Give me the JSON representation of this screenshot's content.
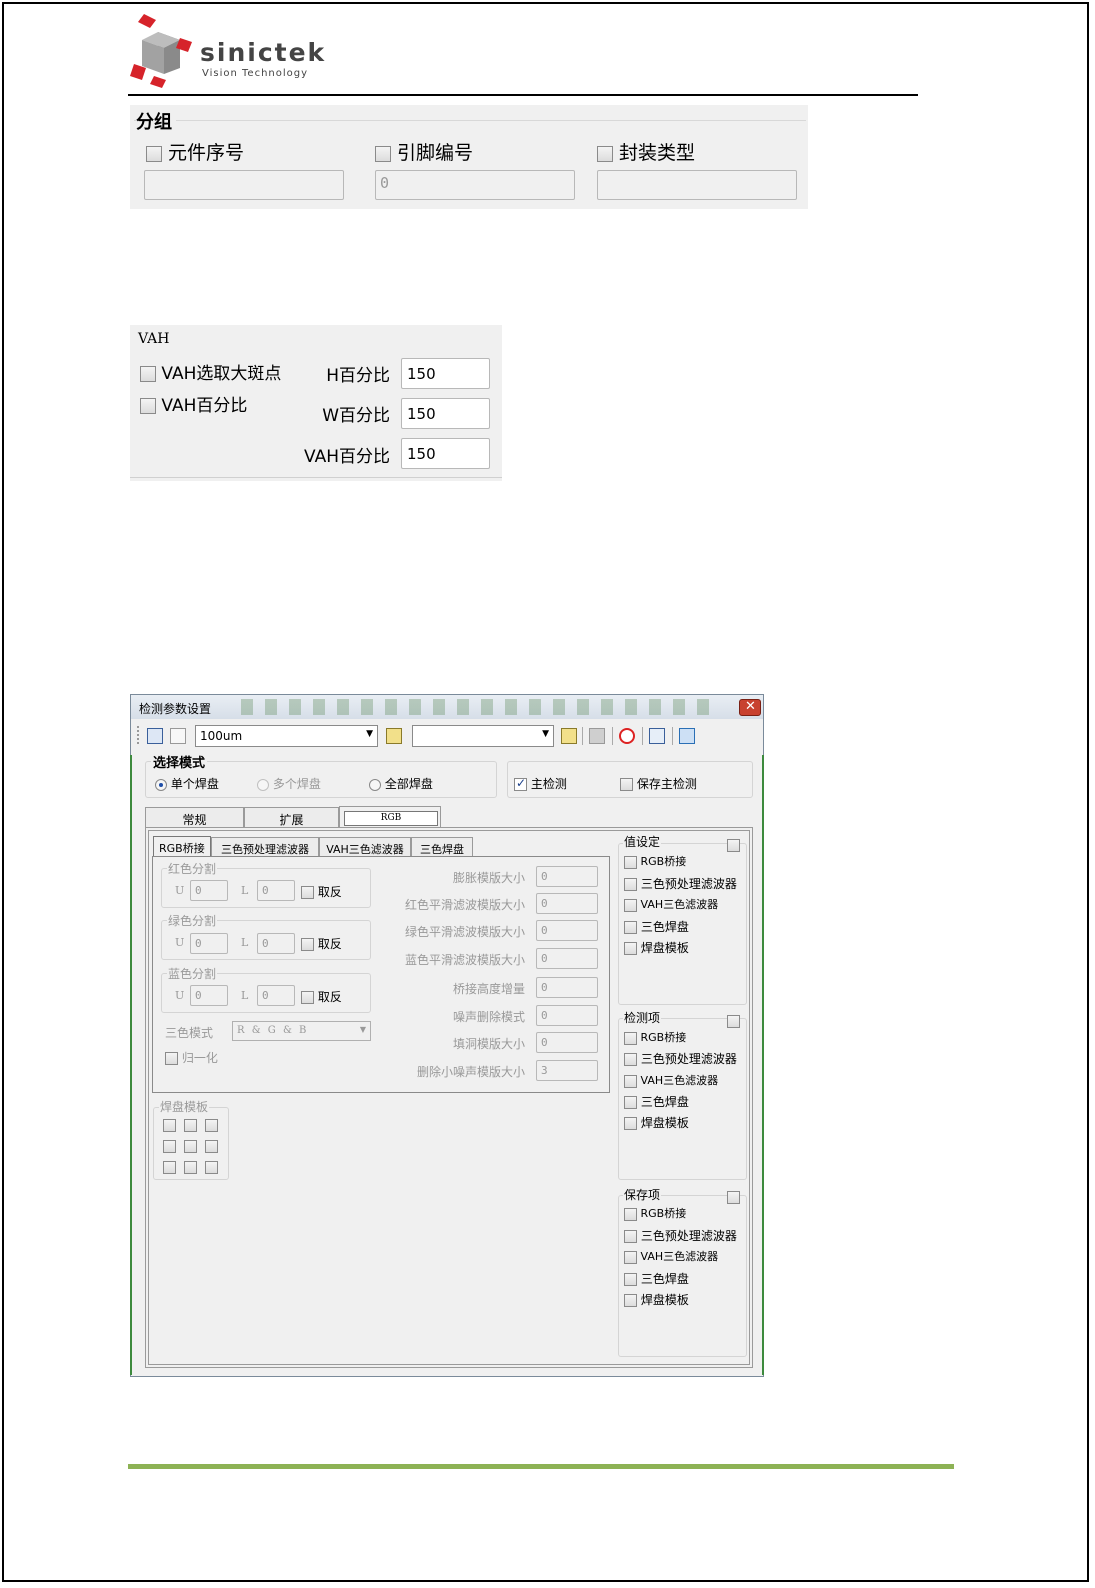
{
  "header": {
    "logo_main": "sinictek",
    "logo_sub": "Vision Technology"
  },
  "group_panel": {
    "title": "分组",
    "fields": [
      {
        "label": "元件序号",
        "value": ""
      },
      {
        "label": "引脚编号",
        "value": "0"
      },
      {
        "label": "封装类型",
        "value": ""
      }
    ]
  },
  "vah_panel": {
    "title": "VAH",
    "checks": [
      "VAH选取大斑点",
      "VAH百分比"
    ],
    "params": [
      {
        "label": "H百分比",
        "value": "150"
      },
      {
        "label": "W百分比",
        "value": "150"
      },
      {
        "label": "VAH百分比",
        "value": "150"
      }
    ]
  },
  "dialog": {
    "title": "检测参数设置",
    "close_icon": "close-icon",
    "toolbar": {
      "size_select": "100um",
      "second_select": ""
    },
    "mode": {
      "title": "选择模式",
      "options": [
        "单个焊盘",
        "多个焊盘",
        "全部焊盘"
      ],
      "selected": 0
    },
    "main_check": {
      "label": "主检测",
      "checked": true
    },
    "save_main_check": {
      "label": "保存主检测",
      "checked": false
    },
    "tabs": [
      "常规",
      "扩展",
      "RGB"
    ],
    "active_tab": 2,
    "subtabs": [
      "RGB桥接",
      "三色预处理滤波器",
      "VAH三色滤波器",
      "三色焊盘"
    ],
    "active_subtab": 0,
    "splits": [
      {
        "title": "红色分割",
        "u_label": "U",
        "u": "0",
        "l_label": "L",
        "l": "0",
        "invert": "取反"
      },
      {
        "title": "绿色分割",
        "u_label": "U",
        "u": "0",
        "l_label": "L",
        "l": "0",
        "invert": "取反"
      },
      {
        "title": "蓝色分割",
        "u_label": "U",
        "u": "0",
        "l_label": "L",
        "l": "0",
        "invert": "取反"
      }
    ],
    "color_mode": {
      "label": "三色模式",
      "value": "R & G & B"
    },
    "normalize": "归一化",
    "right_params": [
      {
        "label": "膨胀模版大小",
        "value": "0"
      },
      {
        "label": "红色平滑滤波模版大小",
        "value": "0"
      },
      {
        "label": "绿色平滑滤波模版大小",
        "value": "0"
      },
      {
        "label": "蓝色平滑滤波模版大小",
        "value": "0"
      },
      {
        "label": "桥接高度增量",
        "value": "0"
      },
      {
        "label": "噪声删除模式",
        "value": "0"
      },
      {
        "label": "填洞模版大小",
        "value": "0"
      },
      {
        "label": "删除小噪声模版大小",
        "value": "3"
      }
    ],
    "pad_template": {
      "title": "焊盘模板"
    },
    "side_groups": [
      {
        "title": "值设定",
        "items": [
          "RGB桥接",
          "三色预处理滤波器",
          "VAH三色滤波器",
          "三色焊盘",
          "焊盘模板"
        ]
      },
      {
        "title": "检测项",
        "items": [
          "RGB桥接",
          "三色预处理滤波器",
          "VAH三色滤波器",
          "三色焊盘",
          "焊盘模板"
        ]
      },
      {
        "title": "保存项",
        "items": [
          "RGB桥接",
          "三色预处理滤波器",
          "VAH三色滤波器",
          "三色焊盘",
          "焊盘模板"
        ]
      }
    ]
  },
  "colors": {
    "footer_line": "#8db255",
    "dialog_bg": "#f0f0f0",
    "close_button": "#c8412f"
  }
}
